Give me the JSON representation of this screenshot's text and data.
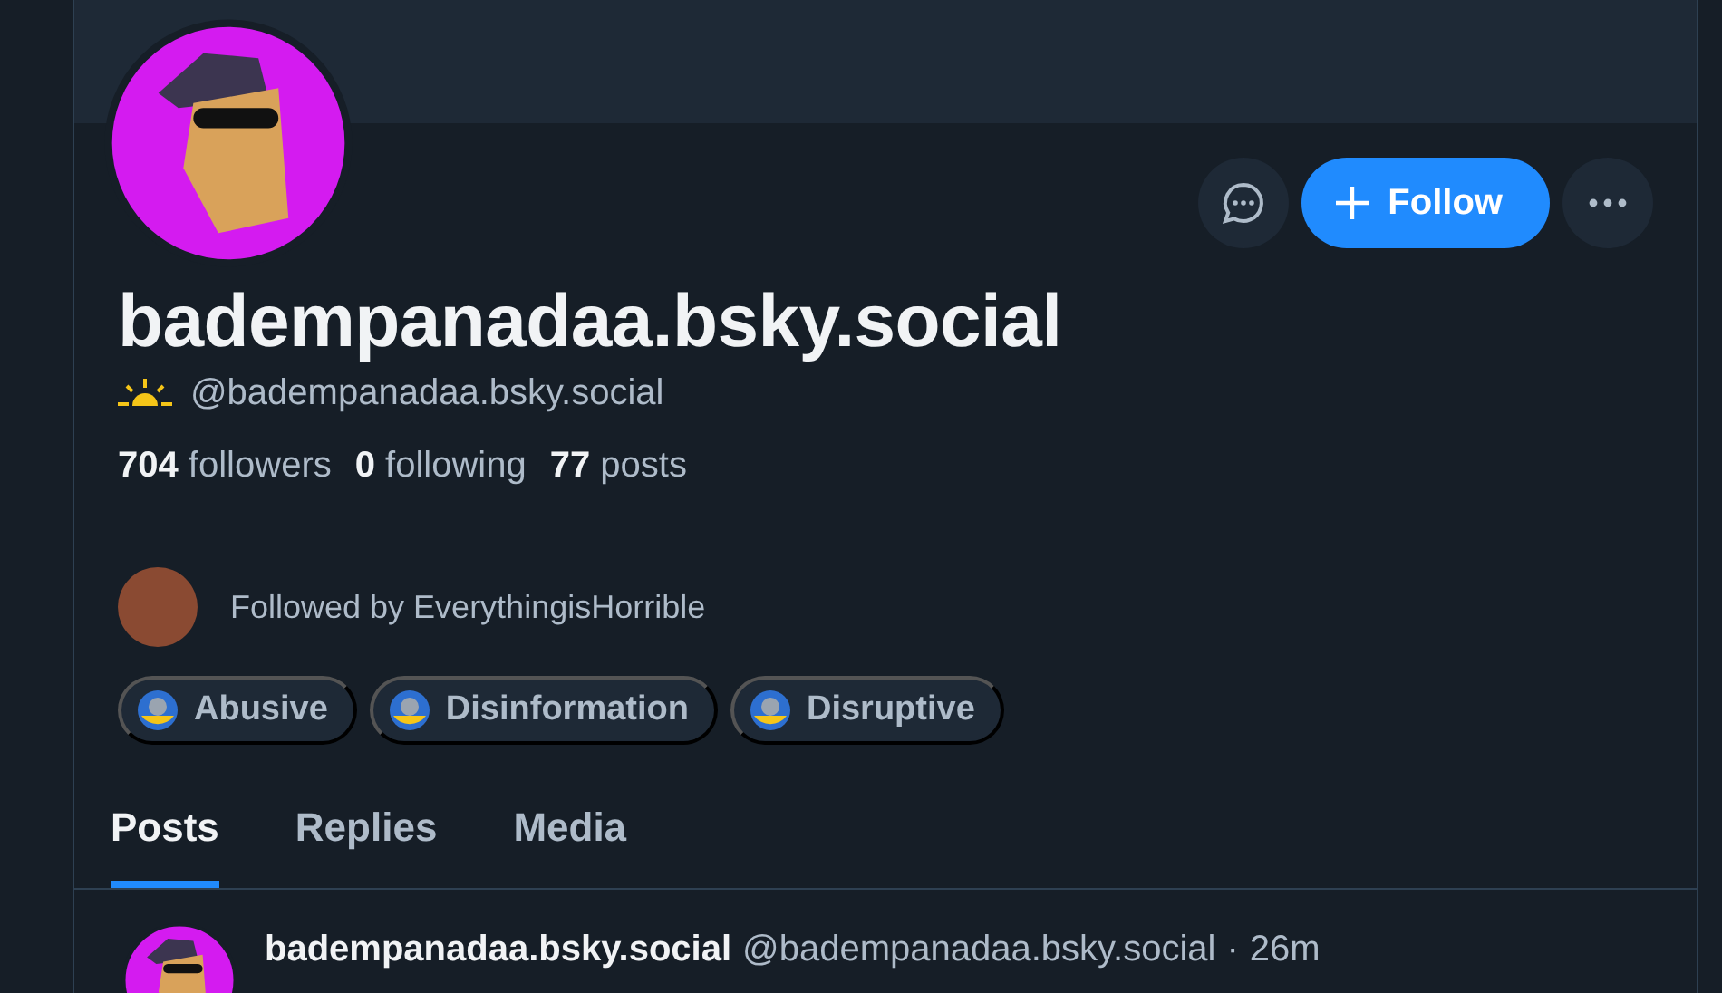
{
  "profile": {
    "display_name": "badempanadaa.bsky.social",
    "handle": "@badempanadaa.bsky.social",
    "stats": [
      {
        "count": "704",
        "label": "followers"
      },
      {
        "count": "0",
        "label": "following"
      },
      {
        "count": "77",
        "label": "posts"
      }
    ],
    "followed_by": "Followed by EverythingisHorrible"
  },
  "actions": {
    "follow": "Follow"
  },
  "labels": [
    {
      "text": "Abusive"
    },
    {
      "text": "Disinformation"
    },
    {
      "text": "Disruptive"
    }
  ],
  "tabs": [
    {
      "label": "Posts",
      "selected": true
    },
    {
      "label": "Replies",
      "selected": false
    },
    {
      "label": "Media",
      "selected": false
    }
  ],
  "post": {
    "author": "badempanadaa.bsky.social",
    "handle": "@badempanadaa.bsky.social",
    "separator": "·",
    "time": "26m"
  }
}
